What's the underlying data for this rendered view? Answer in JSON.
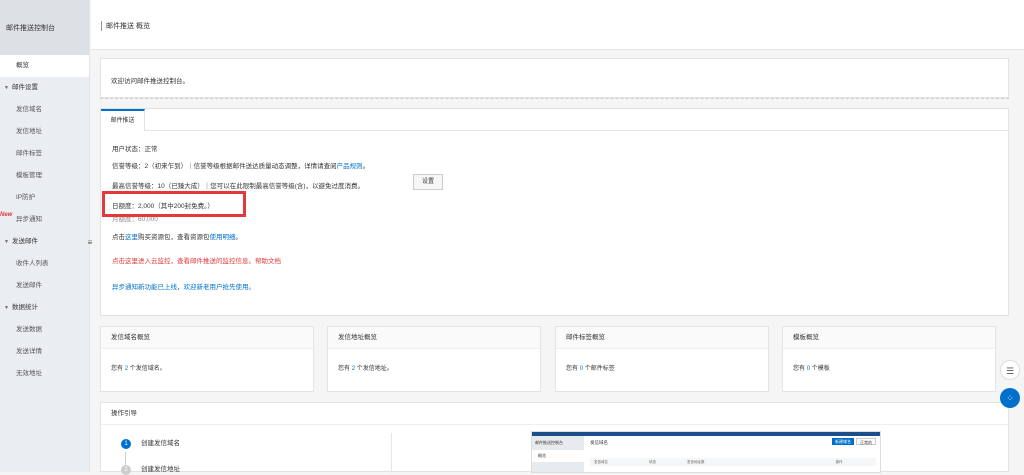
{
  "sidebar": {
    "title": "邮件推送控制台",
    "overview": "概览",
    "groups": [
      {
        "label": "邮件设置",
        "items": [
          "发信域名",
          "发信地址",
          "邮件标签",
          "模板管理",
          "IP防护",
          "异步通知"
        ]
      },
      {
        "label": "发送邮件",
        "items": [
          "收件人列表",
          "发送邮件"
        ]
      },
      {
        "label": "数据统计",
        "items": [
          "发送数据",
          "发送详情",
          "无效地址"
        ]
      }
    ],
    "new_badge": "New",
    "collapse_icon": "≡"
  },
  "header": {
    "breadcrumb": "邮件推送 概览"
  },
  "welcome": "欢迎访问邮件推送控制台。",
  "tab": "邮件推送",
  "status": {
    "user_status": "用户状态：正常",
    "credit_prefix": "信誉等级：2（初来乍到）｜信誉等级根据邮件送达质量动态调整，详情请查阅",
    "credit_link": "产品规则",
    "credit_suffix": "。",
    "max_credit": "最高信誉等级：10（已臻大成）｜您可以在此限制最高信誉等级(含)，以避免过度消费。",
    "settings_button": "设置",
    "daily_quota": "日额度：2,000（其中200封免费。）",
    "monthly_quota": "月额度：60,000",
    "buy_prefix": "点击",
    "buy_link1": "这里",
    "buy_middle": "购买资源包，查看资源包",
    "buy_link2": "使用明细",
    "buy_suffix": "。",
    "monitor": "点击这里进入云监控，查看邮件推送的监控信息。帮助文档",
    "async_notice": "异步通知新功能已上线，欢迎新老用户抢先使用。"
  },
  "cards": [
    {
      "title": "发信域名概览",
      "prefix": "您有",
      "count": "2",
      "suffix": "个发信域名。"
    },
    {
      "title": "发信地址概览",
      "prefix": "您有",
      "count": "2",
      "suffix": "个发信地址。"
    },
    {
      "title": "邮件标签概览",
      "prefix": "您有",
      "count": "0",
      "suffix": "个邮件标签"
    },
    {
      "title": "模板概览",
      "prefix": "您有",
      "count": "0",
      "suffix": "个模板"
    }
  ],
  "guide": {
    "title": "操作引导",
    "steps": [
      {
        "num": "1",
        "label": "创建发信域名"
      },
      {
        "num": "2",
        "label": "创建发信地址"
      }
    ],
    "preview_title": "发信域名",
    "preview_sidebar_title": "邮件推送控制台",
    "preview_sidebar_item": "概览",
    "preview_button": "新建域名",
    "preview_button2": "正常的",
    "preview_headers": [
      "发信域名",
      "状态",
      "发信地址数",
      "操作"
    ]
  },
  "float": {
    "chat_icon": "☰",
    "apps_icon": "⁘"
  }
}
